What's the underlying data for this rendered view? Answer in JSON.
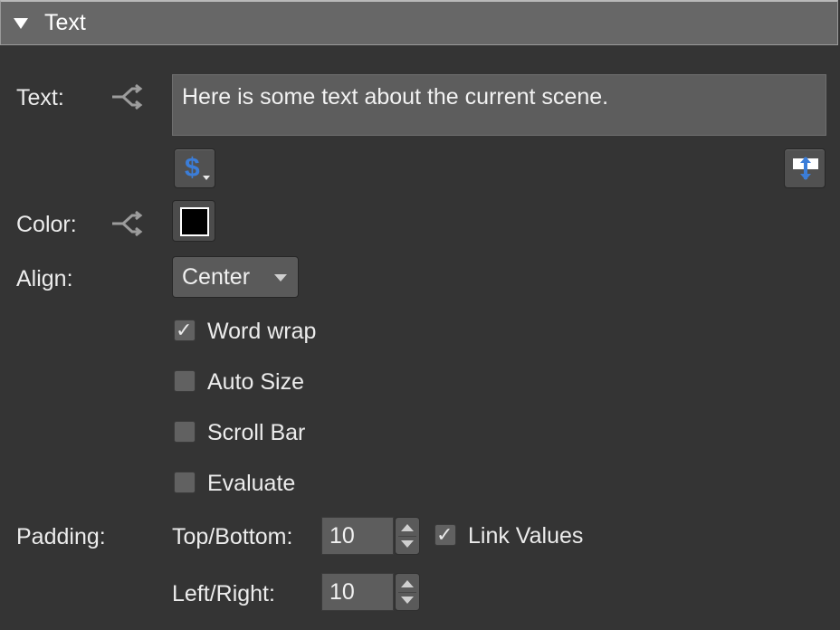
{
  "section": {
    "title": "Text"
  },
  "text_row": {
    "label": "Text:",
    "value": "Here is some text about the current scene.",
    "insert_symbol_glyph": "$",
    "insert_icon": "dollar-insert-icon",
    "expand_icon": "expand-editor-icon",
    "link_icon": "link-branch-icon"
  },
  "color_row": {
    "label": "Color:",
    "value": "#000000",
    "link_icon": "link-branch-icon"
  },
  "align_row": {
    "label": "Align:",
    "selected": "Center"
  },
  "options": [
    {
      "label": "Word wrap",
      "checked": true
    },
    {
      "label": "Auto Size",
      "checked": false
    },
    {
      "label": "Scroll Bar",
      "checked": false
    },
    {
      "label": "Evaluate",
      "checked": false
    }
  ],
  "padding": {
    "label": "Padding:",
    "top_bottom_label": "Top/Bottom:",
    "top_bottom_value": "10",
    "left_right_label": "Left/Right:",
    "left_right_value": "10",
    "link_values_label": "Link Values",
    "link_values_checked": true
  },
  "colors": {
    "background": "#343434",
    "header": "#676767",
    "field": "#5d5d5d",
    "accent_blue": "#3b7dd8"
  }
}
